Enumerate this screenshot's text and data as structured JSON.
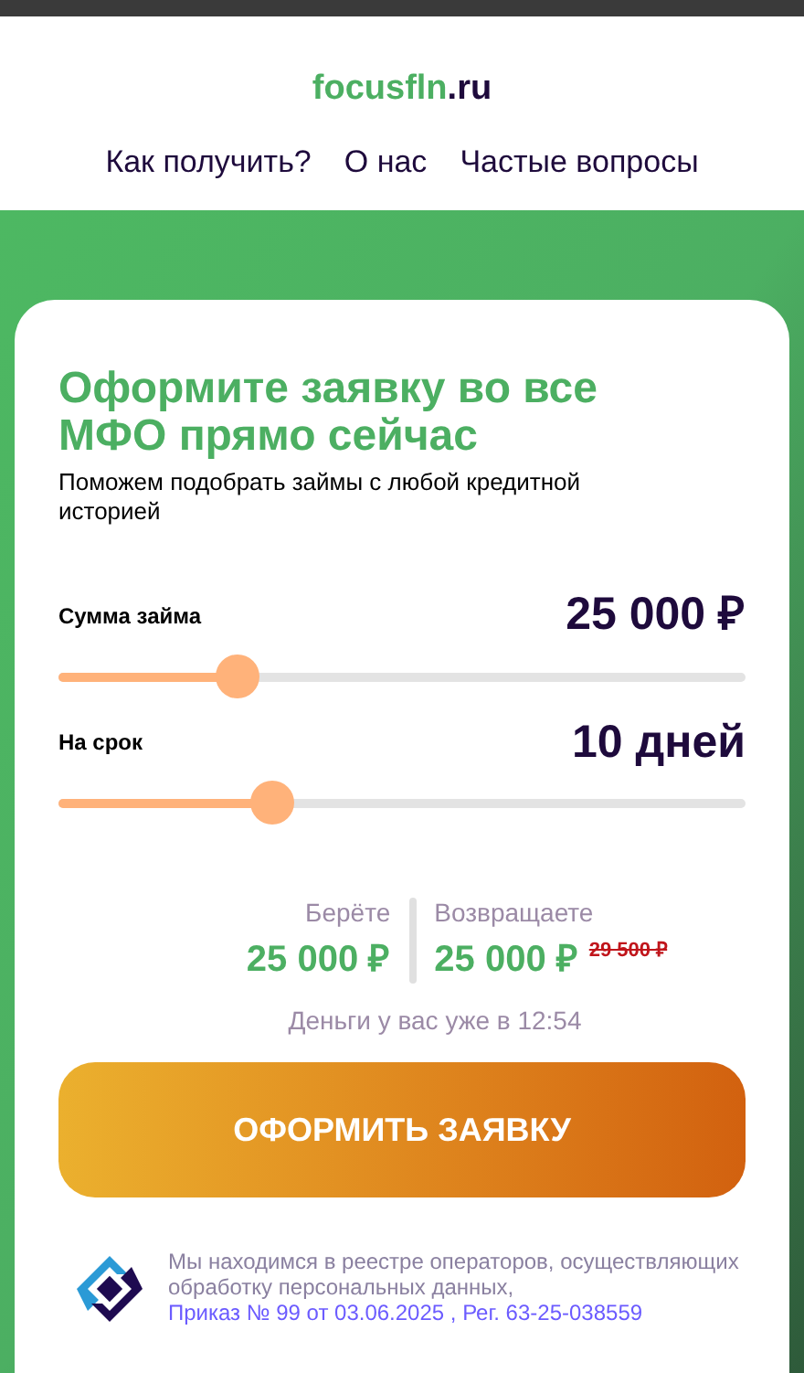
{
  "logo": {
    "name": "focusfln",
    "domain": ".ru"
  },
  "nav": [
    "Как получить?",
    "О нас",
    "Частые вопросы"
  ],
  "form": {
    "title": "Оформите заявку во все МФО прямо сейчас",
    "subtitle": "Поможем подобрать займы с любой кредитной историей",
    "sliders": [
      {
        "label": "Сумма займа",
        "value": "25 000 ₽",
        "level": 0.26
      },
      {
        "label": "На срок",
        "value": "10 дней",
        "level": 0.31
      }
    ],
    "take": {
      "label": "Берёте",
      "amount": "25 000 ₽"
    },
    "return": {
      "label": "Возвращаете",
      "amount": "25 000 ₽",
      "old_amount": "29 500 ₽"
    },
    "eta": "Деньги у вас уже в 12:54",
    "submit": "ОФОРМИТЬ ЗАЯВКУ",
    "registry": {
      "text": "Мы находимся в реестре операторов, осуществляющих обработку персональных данных,",
      "link": "Приказ № 99 от 03.06.2025 , Рег. 63-25-038559"
    }
  }
}
